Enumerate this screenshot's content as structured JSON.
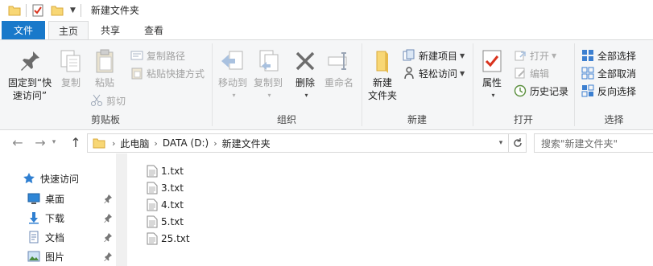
{
  "window": {
    "title": "新建文件夹"
  },
  "ribbon_tabs": {
    "file": "文件",
    "home": "主页",
    "share": "共享",
    "view": "查看"
  },
  "clipboard": {
    "pin_line1": "固定到“快",
    "pin_line2": "速访问”",
    "copy": "复制",
    "paste": "粘贴",
    "copy_path": "复制路径",
    "paste_shortcut": "粘贴快捷方式",
    "cut": "剪切",
    "label": "剪贴板"
  },
  "organize": {
    "move_to": "移动到",
    "copy_to": "复制到",
    "delete": "删除",
    "rename": "重命名",
    "label": "组织"
  },
  "new": {
    "new_folder_line1": "新建",
    "new_folder_line2": "文件夹",
    "new_item": "新建项目",
    "easy_access": "轻松访问",
    "label": "新建"
  },
  "open": {
    "properties": "属性",
    "open": "打开",
    "edit": "编辑",
    "history": "历史记录",
    "label": "打开"
  },
  "select": {
    "select_all": "全部选择",
    "select_none": "全部取消",
    "invert": "反向选择",
    "label": "选择"
  },
  "address": {
    "crumbs": [
      "此电脑",
      "DATA (D:)",
      "新建文件夹"
    ],
    "search_placeholder": "搜索\"新建文件夹\""
  },
  "navpane": {
    "items": [
      {
        "label": "快速访问",
        "icon": "star-icon"
      },
      {
        "label": "桌面",
        "icon": "desktop-icon"
      },
      {
        "label": "下载",
        "icon": "download-icon"
      },
      {
        "label": "文档",
        "icon": "document-icon"
      },
      {
        "label": "图片",
        "icon": "picture-icon"
      }
    ]
  },
  "files": [
    "1.txt",
    "3.txt",
    "4.txt",
    "5.txt",
    "25.txt"
  ],
  "colors": {
    "accent": "#1979ca",
    "ribbon_bg": "#f5f6f7",
    "folder": "#f8d775"
  }
}
